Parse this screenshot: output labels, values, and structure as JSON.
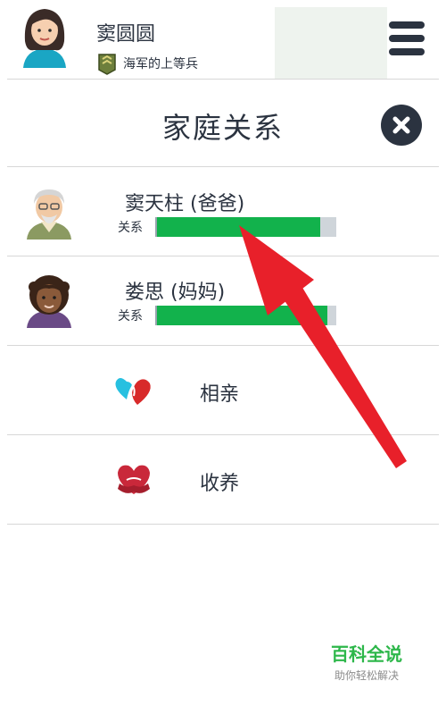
{
  "header": {
    "character_name": "窦圆圆",
    "rank": "海军的上等兵",
    "avatar_icon": "woman-avatar-icon",
    "rank_icon": "military-rank-icon",
    "menu_icon": "hamburger-menu-icon"
  },
  "page": {
    "title": "家庭关系",
    "close_icon": "close-icon"
  },
  "relatives": [
    {
      "name": "窦天柱 (爸爸)",
      "relation_label": "关系",
      "relation_level": 0.91,
      "avatar_icon": "old-man-avatar-icon"
    },
    {
      "name": "娄思 (妈妈)",
      "relation_label": "关系",
      "relation_level": 0.95,
      "avatar_icon": "woman-curly-hair-avatar-icon"
    }
  ],
  "actions": [
    {
      "label": "相亲",
      "icon": "dating-hearts-icon"
    },
    {
      "label": "收养",
      "icon": "adoption-heart-hands-icon"
    }
  ],
  "watermark": {
    "title": "百科全说",
    "subtitle": "助你轻松解决"
  },
  "colors": {
    "text_dark": "#2b3340",
    "bar_fill": "#12b24c",
    "bar_track": "#cfd5da",
    "arrow_red": "#e8202a",
    "watermark_green": "#2db74a"
  }
}
